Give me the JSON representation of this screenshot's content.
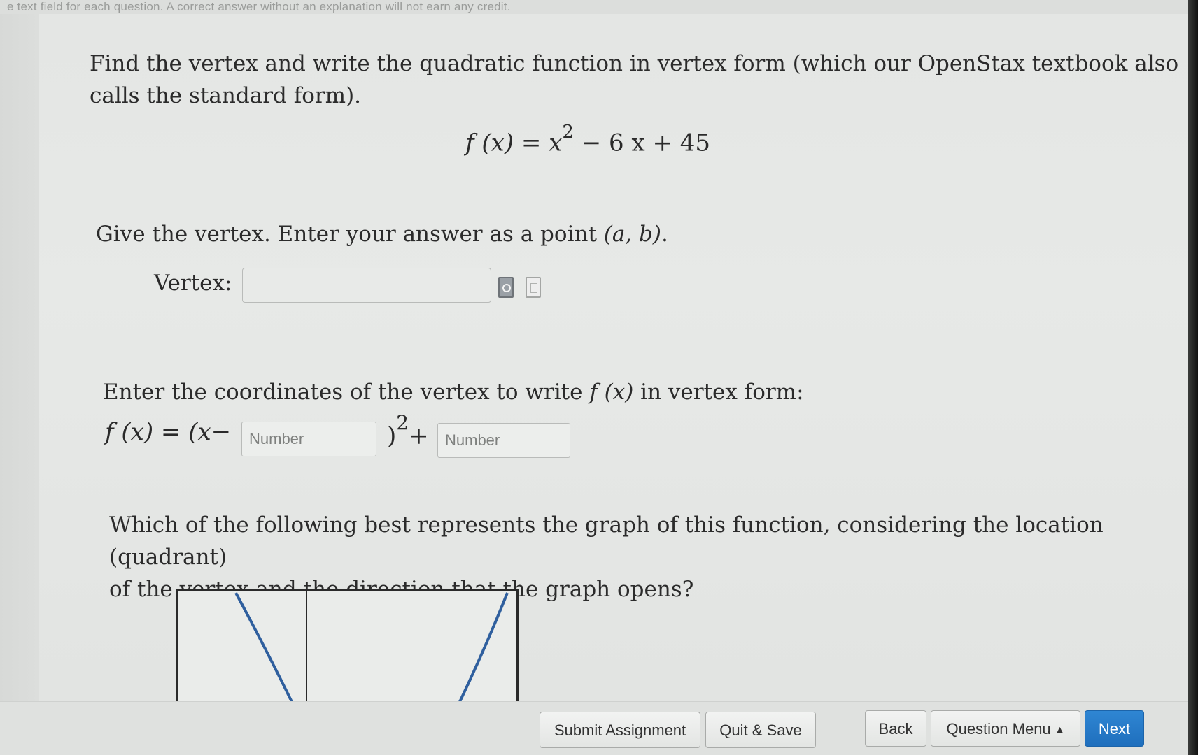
{
  "header": {
    "instructions_tail": "e text field for each question. A correct answer without an explanation will not earn any credit."
  },
  "question": {
    "intro_line1": "Find the vertex and write the quadratic function in vertex form (which our OpenStax textbook also",
    "intro_line2": "calls the standard form).",
    "equation_lhs": "f (x) = x",
    "equation_exp": "2",
    "equation_rhs": " − 6 x + 45"
  },
  "part1": {
    "prompt_text": "Give the vertex. Enter your answer as a point ",
    "prompt_point": "(a, b)",
    "prompt_end": ".",
    "vertex_label": "Vertex:",
    "vertex_value": ""
  },
  "part2": {
    "prompt_text": "Enter the coordinates of the vertex to write ",
    "prompt_fx": "f (x)",
    "prompt_end": " in vertex form:",
    "lhs": "f (x) = (x−",
    "close_paren": ")",
    "exponent": "2",
    "plus": "+",
    "h_placeholder": "Number",
    "k_placeholder": "Number"
  },
  "part3": {
    "prompt_line1": "Which of the following best represents the graph of this function, considering the location (quadrant)",
    "prompt_line2": "of the vertex and the direction that the graph opens?"
  },
  "footer": {
    "submit_label": "Submit Assignment",
    "quit_label": "Quit & Save",
    "back_label": "Back",
    "menu_label": "Question Menu",
    "next_label": "Next"
  },
  "colors": {
    "next_button": "#2478c7",
    "graph_curve": "#2f5f9e"
  }
}
